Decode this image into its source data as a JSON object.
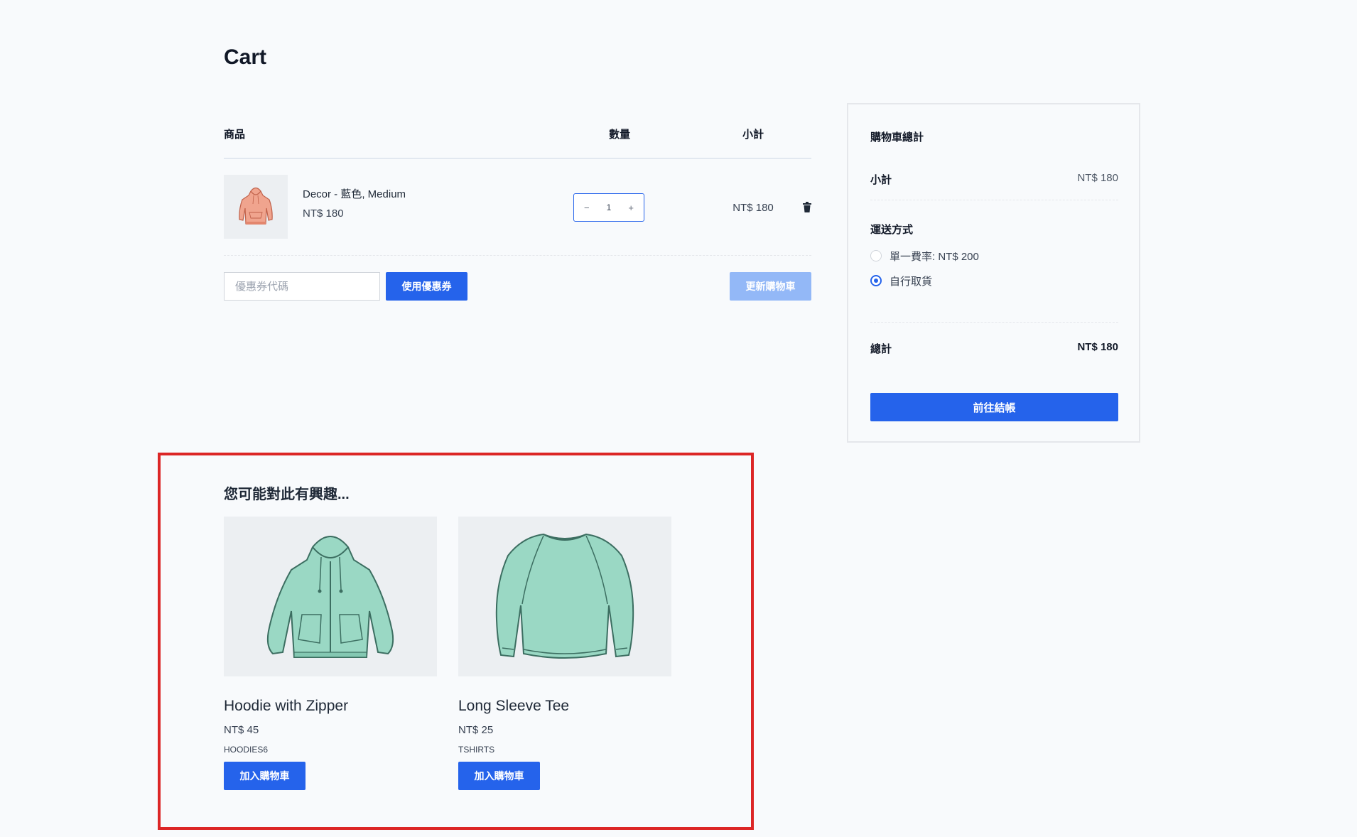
{
  "page": {
    "title": "Cart"
  },
  "cart": {
    "headers": {
      "product": "商品",
      "quantity": "數量",
      "subtotal": "小計"
    },
    "items": [
      {
        "name": "Decor - 藍色, Medium",
        "price": "NT$ 180",
        "quantity": "1",
        "line_total": "NT$ 180"
      }
    ],
    "coupon": {
      "placeholder": "優惠券代碼",
      "apply_label": "使用優惠券"
    },
    "update_label": "更新購物車"
  },
  "totals": {
    "title": "購物車總計",
    "subtotal_label": "小計",
    "subtotal_value": "NT$ 180",
    "shipping_title": "運送方式",
    "shipping_options": [
      {
        "label": "單一費率: NT$ 200",
        "selected": false
      },
      {
        "label": "自行取貨",
        "selected": true
      }
    ],
    "total_label": "總計",
    "total_value": "NT$ 180",
    "checkout_label": "前往結帳"
  },
  "recommendations": {
    "title": "您可能對此有興趣...",
    "products": [
      {
        "name": "Hoodie with Zipper",
        "price": "NT$ 45",
        "category": "HOODIES6",
        "add_label": "加入購物車"
      },
      {
        "name": "Long Sleeve Tee",
        "price": "NT$ 25",
        "category": "TSHIRTS",
        "add_label": "加入購物車"
      }
    ]
  },
  "colors": {
    "accent": "#2563eb",
    "accent_disabled": "#93b8f7",
    "highlight_border": "#dc2626",
    "garment_mint": "#9ad8c4",
    "garment_salmon": "#f0a48e"
  },
  "icons": {
    "minus": "minus-icon",
    "plus": "plus-icon",
    "trash": "trash-icon"
  }
}
